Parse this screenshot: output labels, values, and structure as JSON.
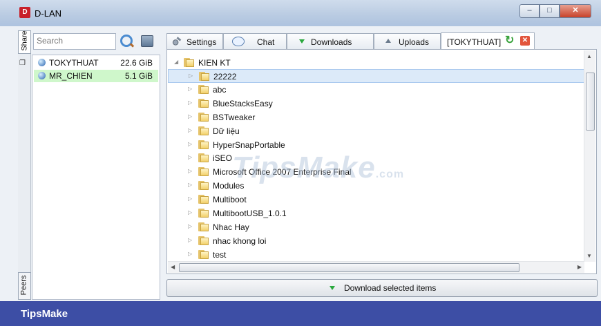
{
  "window": {
    "title": "D-LAN",
    "icon_text": "D"
  },
  "dock": {
    "share_tab": "Share",
    "peers_tab": "Peers"
  },
  "search": {
    "placeholder": "Search",
    "value": ""
  },
  "peers": [
    {
      "name": "TOKYTHUAT",
      "size": "22.6 GiB"
    },
    {
      "name": "MR_CHIEN",
      "size": "5.1 GiB"
    }
  ],
  "tabs": {
    "settings": "Settings",
    "chat": "Chat",
    "downloads": "Downloads",
    "uploads": "Uploads",
    "browse": "[TOKYTHUAT]"
  },
  "tree": {
    "root": "KIEN KT",
    "items": [
      "22222",
      "abc",
      "BlueStacksEasy",
      "BSTweaker",
      "Dữ liệu",
      "HyperSnapPortable",
      "iSEO",
      "Microsoft Office 2007 Enterprise Final",
      "Modules",
      "Multiboot",
      "MultibootUSB_1.0.1",
      "Nhac Hay",
      "nhac khong loi",
      "test"
    ]
  },
  "actions": {
    "download_selected": "Download selected items"
  },
  "branding": {
    "name": "TipsMake",
    "watermark": "TipsMake",
    "watermark_suffix": ".com"
  },
  "colors": {
    "selected_peer": "#cff7cb",
    "selected_row": "#dceaf9",
    "brand_bar": "#3d4ea5",
    "accent_green": "#29a83c"
  }
}
